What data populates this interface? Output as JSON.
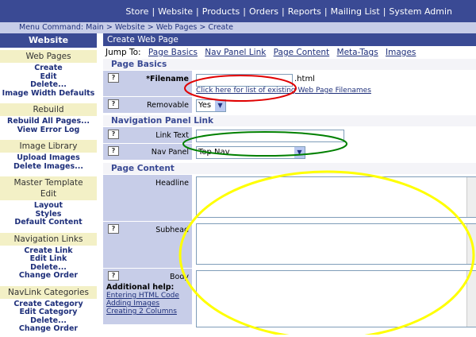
{
  "topnav": {
    "items": [
      "Store",
      "Website",
      "Products",
      "Orders",
      "Reports",
      "Mailing List",
      "System Admin"
    ]
  },
  "breadcrumb": "Menu Command: Main > Website > Web Pages > Create",
  "sidebar": {
    "title": "Website",
    "sections": [
      {
        "heading": "Web Pages",
        "links": [
          "Create",
          "Edit",
          "Delete...",
          "Image Width Defaults"
        ]
      },
      {
        "heading": "Rebuild",
        "links": [
          "Rebuild All Pages...",
          "View Error Log"
        ]
      },
      {
        "heading": "Image Library",
        "links": [
          "Upload Images",
          "Delete Images..."
        ]
      },
      {
        "heading": "Master Template Edit",
        "links": [
          "Layout",
          "Styles",
          "Default Content"
        ]
      },
      {
        "heading": "Navigation Links",
        "links": [
          "Create Link",
          "Edit Link",
          "Delete...",
          "Change Order"
        ]
      },
      {
        "heading": "NavLink Categories",
        "links": [
          "Create Category",
          "Edit Category",
          "Delete...",
          "Change Order"
        ]
      }
    ]
  },
  "main": {
    "title": "Create Web Page",
    "jump_label": "Jump To:",
    "jump_links": [
      "Page Basics",
      "Nav Panel Link",
      "Page Content",
      "Meta-Tags",
      "Images"
    ],
    "page_basics": {
      "heading": "Page Basics",
      "filename_label": "*Filename",
      "filename_suffix": ".html",
      "filename_link": "Click here for list of existing Web Page Filenames",
      "removable_label": "Removable",
      "removable_value": "Yes"
    },
    "nav_panel": {
      "heading": "Navigation Panel Link",
      "link_text_label": "Link Text",
      "nav_panel_label": "Nav Panel",
      "nav_panel_value": "Top Nav"
    },
    "page_content": {
      "heading": "Page Content",
      "headline_label": "Headline",
      "subhead_label": "Subhead",
      "body_label": "Body",
      "additional_help": "Additional help:",
      "help_links": [
        "Entering HTML Code",
        "Adding Images",
        "Creating 2 Columns"
      ]
    }
  },
  "help_icon_text": "?",
  "colors": {
    "nav_blue": "#3a4a94",
    "label_bg": "#c7cde8",
    "section_bg": "#f3f0c6",
    "annotation_red": "#e00000",
    "annotation_green": "#008000",
    "annotation_yellow": "#ffff00"
  }
}
